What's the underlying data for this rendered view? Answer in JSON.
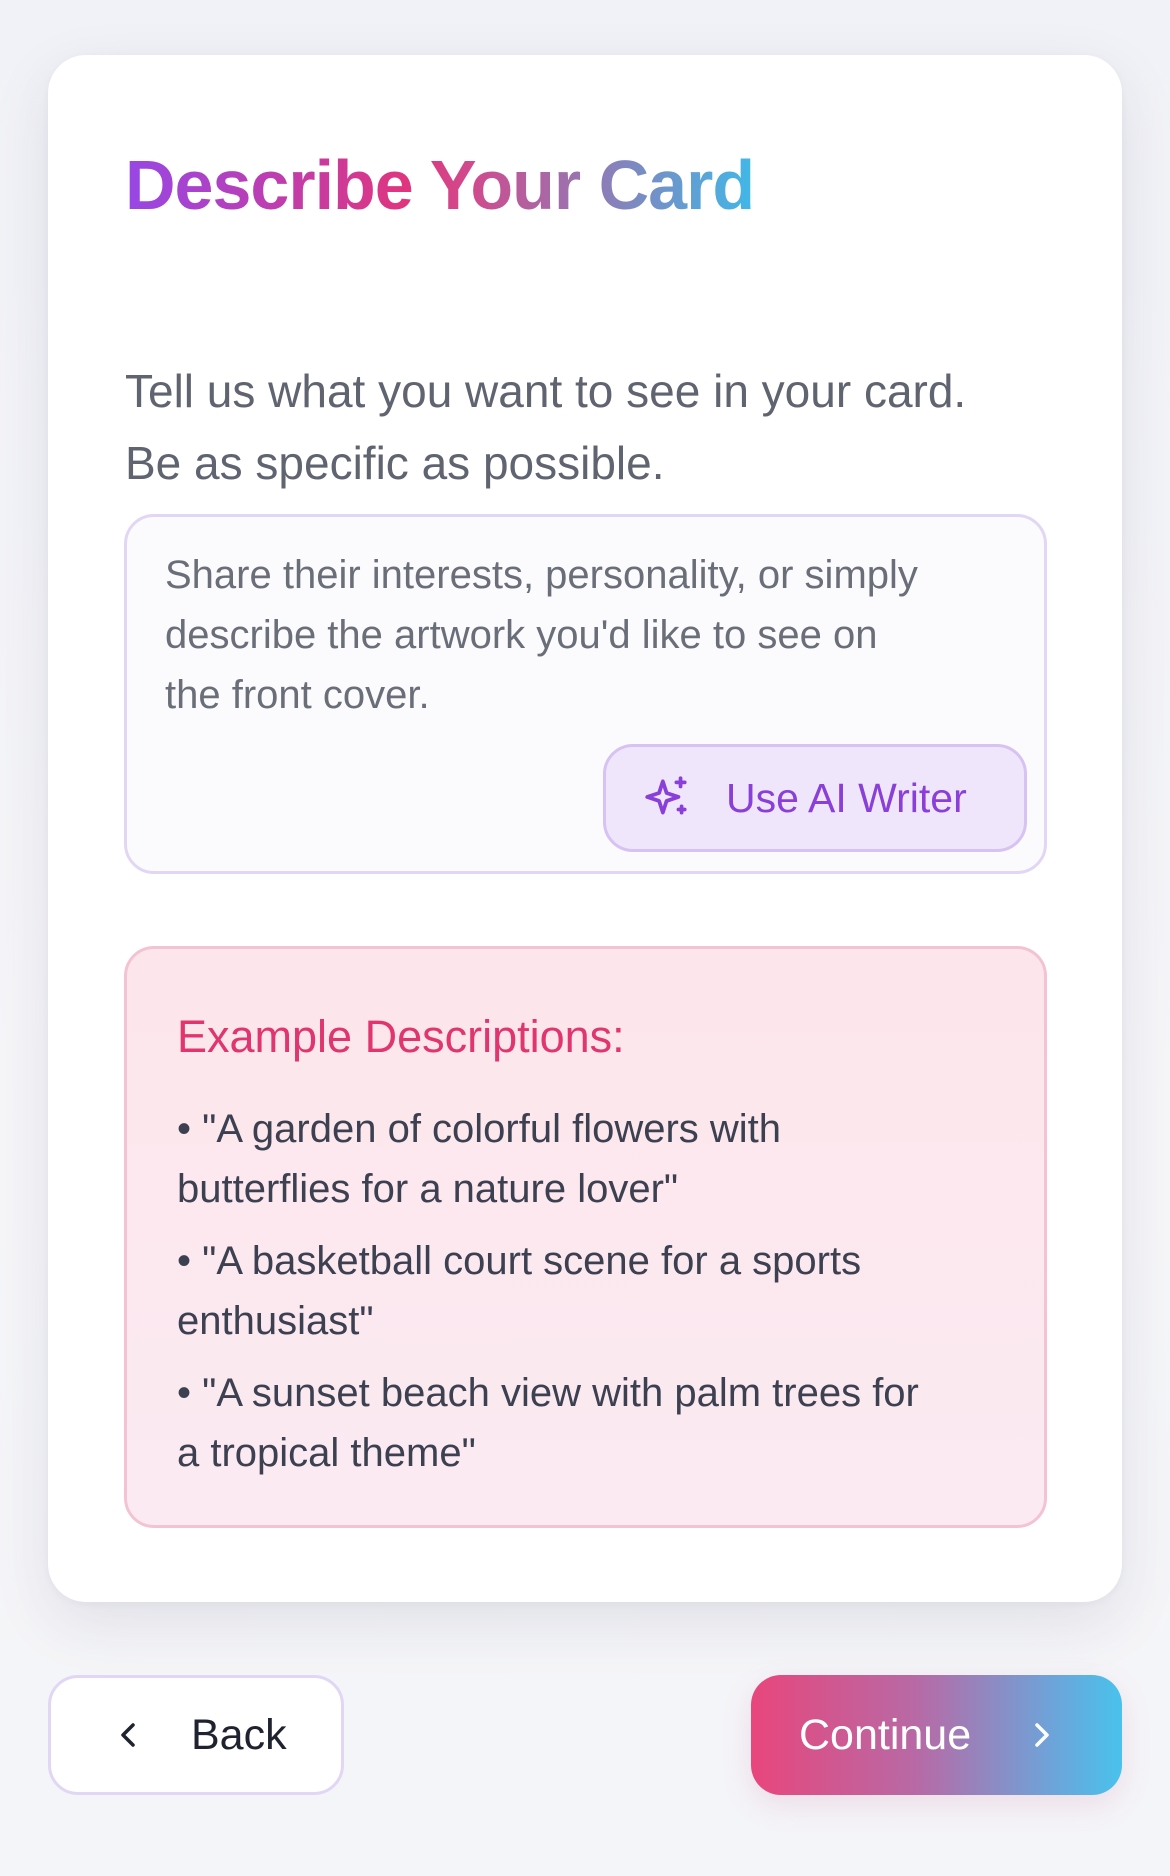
{
  "card": {
    "title": "Describe Your Card",
    "subtitle_lines": [
      "Tell us what you want to see in your card.",
      "Be as specific as possible."
    ]
  },
  "description_input": {
    "placeholder_lines": [
      "Share their interests, personality, or simply",
      "describe the artwork you'd like to see on",
      "the front cover."
    ],
    "value": ""
  },
  "ai_writer": {
    "label": "Use AI Writer",
    "icon": "sparkles-icon"
  },
  "examples": {
    "title": "Example Descriptions:",
    "items": [
      {
        "lines": [
          "• \"A garden of colorful flowers with",
          "butterflies for a nature lover\""
        ]
      },
      {
        "lines": [
          "• \"A basketball court scene for a sports",
          "enthusiast\""
        ]
      },
      {
        "lines": [
          "• \"A sunset beach view with palm trees for",
          "a tropical theme\""
        ]
      }
    ]
  },
  "navigation": {
    "back_label": "Back",
    "continue_label": "Continue",
    "back_icon": "chevron-left-icon",
    "continue_icon": "chevron-right-icon"
  },
  "colors": {
    "accent_purple": "#8a3fd8",
    "accent_pink": "#e0356e",
    "accent_blue": "#49c2ec"
  }
}
